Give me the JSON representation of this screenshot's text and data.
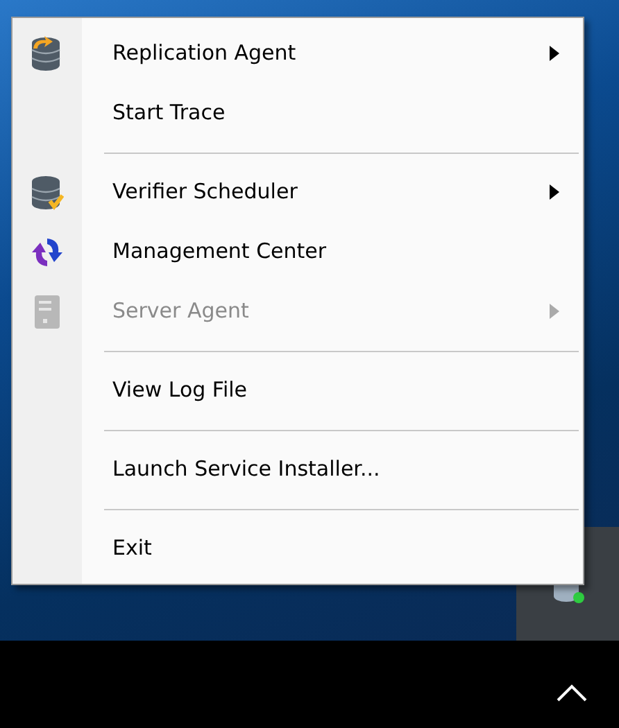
{
  "menu": {
    "items": [
      {
        "kind": "item",
        "label": "Replication Agent",
        "submenu": true,
        "disabled": false
      },
      {
        "kind": "item",
        "label": "Start Trace",
        "submenu": false,
        "disabled": false
      },
      {
        "kind": "separator"
      },
      {
        "kind": "item",
        "label": "Verifier Scheduler",
        "submenu": true,
        "disabled": false
      },
      {
        "kind": "item",
        "label": "Management Center",
        "submenu": false,
        "disabled": false
      },
      {
        "kind": "item",
        "label": "Server Agent",
        "submenu": true,
        "disabled": true
      },
      {
        "kind": "separator"
      },
      {
        "kind": "item",
        "label": "View Log File",
        "submenu": false,
        "disabled": false
      },
      {
        "kind": "separator"
      },
      {
        "kind": "item",
        "label": "Launch Service Installer...",
        "submenu": false,
        "disabled": false
      },
      {
        "kind": "separator"
      },
      {
        "kind": "item",
        "label": "Exit",
        "submenu": false,
        "disabled": false
      }
    ]
  }
}
